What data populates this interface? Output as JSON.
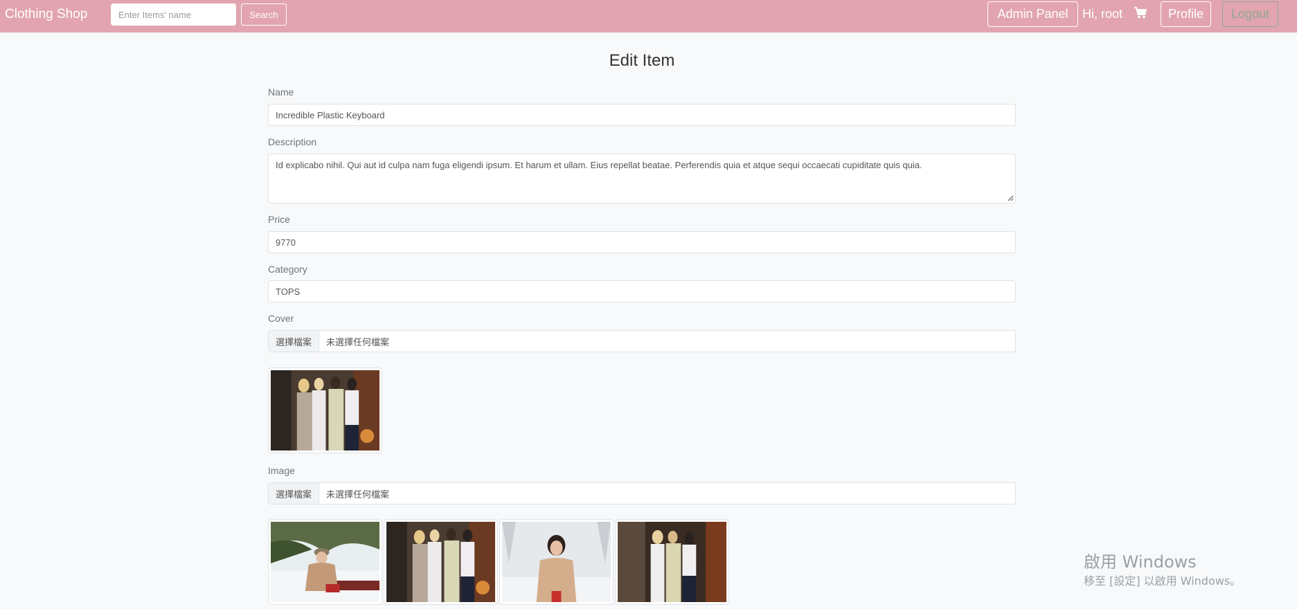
{
  "navbar": {
    "brand": "Clothing Shop",
    "search_placeholder": "Enter Items' name",
    "search_label": "Search",
    "admin_label": "Admin Panel",
    "greeting": "Hi, root",
    "profile_label": "Profile",
    "logout_label": "Logout",
    "color": "#e2a4b0"
  },
  "form": {
    "title": "Edit Item",
    "name_label": "Name",
    "name_value": "Incredible Plastic Keyboard",
    "description_label": "Description",
    "description_value": "Id explicabo nihil. Qui aut id culpa nam fuga eligendi ipsum. Et harum et ullam. Eius repellat beatae. Perferendis quia et atque sequi occaecati cupiditate quis quia.",
    "price_label": "Price",
    "price_value": "9770",
    "category_label": "Category",
    "category_value": "TOPS",
    "cover_label": "Cover",
    "cover_button": "選擇檔案",
    "cover_status": "未選擇任何檔案",
    "image_label": "Image",
    "image_button": "選擇檔案",
    "image_status": "未選擇任何檔案"
  },
  "watermark": {
    "title": "啟用 Windows",
    "subtitle": "移至 [設定] 以啟用 Windows。"
  }
}
